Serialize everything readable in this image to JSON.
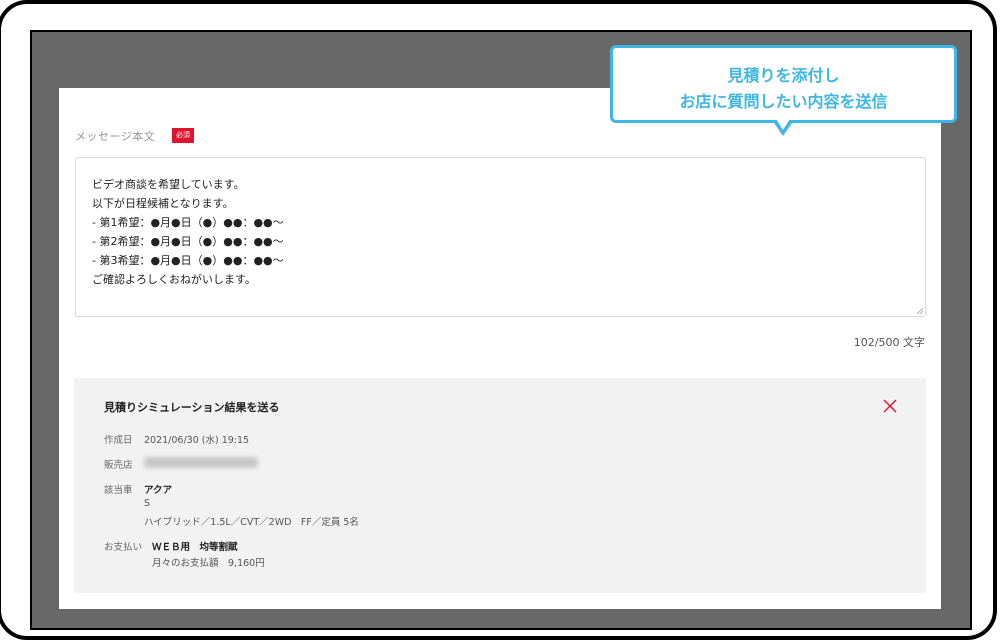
{
  "message": {
    "label": "メッセージ本文",
    "required_badge": "必須",
    "lines": [
      "ビデオ商談を希望しています。",
      "以下が日程候補となります。",
      "- 第1希望：●月●日（●）●●：●●～",
      "- 第2希望：●月●日（●）●●：●●～",
      "- 第3希望：●月●日（●）●●：●●～",
      "ご確認よろしくおねがいします。"
    ],
    "counter": "102/500 文字"
  },
  "estimate": {
    "title": "見積りシミュレーション結果を送る",
    "created_label": "作成日",
    "created_value": "2021/06/30 (水) 19:15",
    "dealer_label": "販売店",
    "vehicle_label": "該当車",
    "vehicle_name": "アクア",
    "vehicle_grade": "S",
    "vehicle_spec": "ハイブリッド／1.5L／CVT／2WD　FF／定員 5名",
    "payment_label": "お支払い",
    "payment_method": "ＷＥＢ用　均等割賦",
    "payment_monthly": "月々のお支払額　9,160円"
  },
  "callout": {
    "line1": "見積りを添付し",
    "line2": "お店に質問したい内容を送信"
  },
  "colors": {
    "accent_red": "#e0142e",
    "callout_blue": "#3fb6e3",
    "screen_gray": "#686868"
  }
}
